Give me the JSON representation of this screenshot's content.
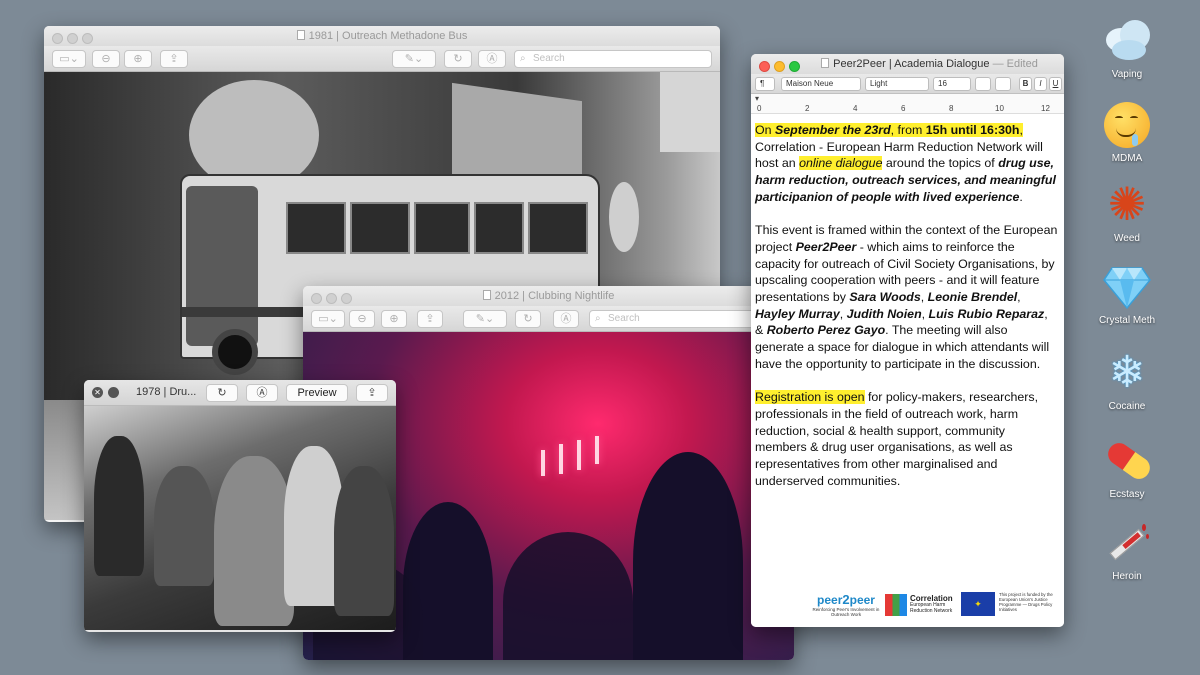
{
  "windows": {
    "outreach_bus": {
      "title": "1981 | Outreach Methadone Bus",
      "search_placeholder": "Search"
    },
    "clubbing": {
      "title": "2012 | Clubbing Nightlife",
      "search_placeholder": "Search"
    },
    "drugs_1978": {
      "title": "1978 | Dru...",
      "preview_label": "Preview"
    },
    "textedit": {
      "title": "Peer2Peer | Academia Dialogue",
      "edited": "— Edited",
      "paragraph_style": "¶",
      "font_family": "Maison Neue",
      "font_weight": "Light",
      "font_size": "16",
      "bold_label": "B",
      "italic_label": "I",
      "underline_label": "U",
      "ruler_numbers": [
        "0",
        "2",
        "4",
        "6",
        "8",
        "10",
        "12"
      ],
      "p1": {
        "a": "On ",
        "b": "September the 23rd",
        "c": ", from ",
        "d": "15h until 16:30h",
        "e": ",",
        "f": " Correlation - European Harm Reduction Network will host an ",
        "g": "online dialogue",
        "h": " around the topics of ",
        "i": "drug use, harm reduction, outreach services, and meaningful participanion of people with lived experience",
        "j": "."
      },
      "p2": {
        "a": "This event is framed within the context of the European project ",
        "b": "Peer2Peer",
        "c": " - which aims to reinforce the capacity for outreach of Civil Society Organisations, by upscaling cooperation with peers - and it will feature presentations by ",
        "d": "Sara Woods",
        "e": ", ",
        "f": "Leonie Brendel",
        "g": ", ",
        "h": "Hayley Murray",
        "i": ", ",
        "j": "Judith Noien",
        "k": ", ",
        "l": "Luis Rubio Reparaz",
        "m": ", & ",
        "n": "Roberto Perez Gayo",
        "o": ". The meeting will also generate a space for dialogue in which attendants will have the opportunity to participate in the discussion."
      },
      "p3": {
        "a": "Registration is open",
        "b": " for policy-makers, researchers, professionals in the field of outreach work, harm reduction, social & health support, community members & drug user organisations, as well as representatives from other marginalised and underserved communities."
      },
      "logos": {
        "peer": "peer",
        "two": "2",
        "peer2": "peer",
        "peer_tagline": "Reinforcing Peer's Involvement in Outreach Work",
        "correlation": "Correlation",
        "correlation_sub": "European Harm Reduction Network",
        "eu_text": "This project is funded by the European Union's Justice Programme — Drugs Policy Initiatives"
      }
    }
  },
  "dock": [
    {
      "label": "Vaping",
      "icon": "vape-cloud-icon"
    },
    {
      "label": "MDMA",
      "icon": "drooling-face-icon"
    },
    {
      "label": "Weed",
      "icon": "maple-leaf-icon"
    },
    {
      "label": "Crystal Meth",
      "icon": "diamond-icon"
    },
    {
      "label": "Cocaine",
      "icon": "snowflake-icon"
    },
    {
      "label": "Ecstasy",
      "icon": "pill-icon"
    },
    {
      "label": "Heroin",
      "icon": "syringe-icon"
    }
  ],
  "colors": {
    "desktop": "#7d8a96",
    "highlight": "#ffef2e",
    "club_pink": "#ff2a6e"
  }
}
